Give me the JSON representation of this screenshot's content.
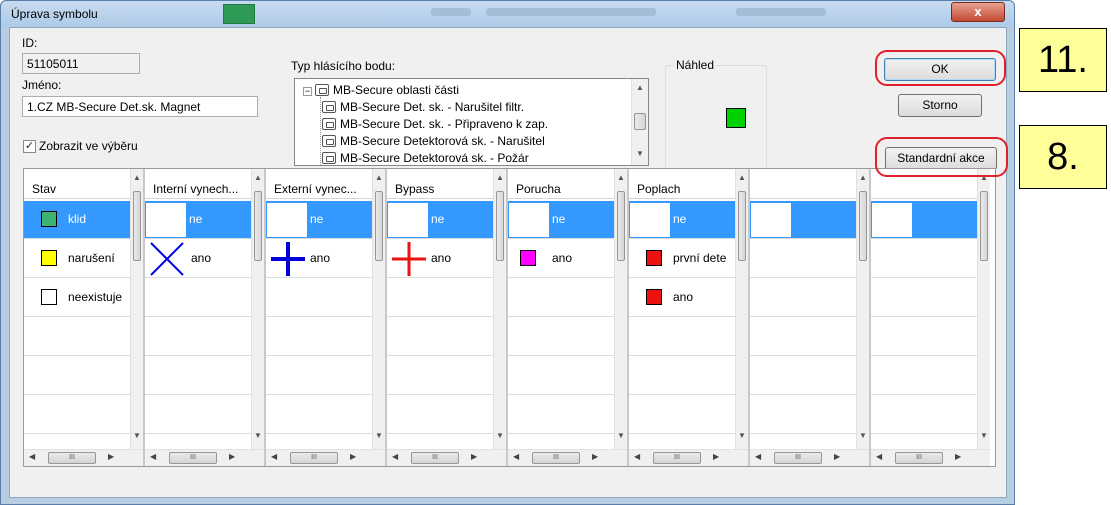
{
  "window": {
    "title": "Úprava symbolu",
    "close_label": "x"
  },
  "form": {
    "id_label": "ID:",
    "id_value": "51105011",
    "name_label": "Jméno:",
    "name_value": "1.CZ MB-Secure Det.sk. Magnet",
    "show_in_selection_label": "Zobrazit ve výběru",
    "show_in_selection_checked": true
  },
  "tree": {
    "label": "Typ hlásícího bodu:",
    "items": [
      {
        "label": "MB-Secure oblasti části",
        "level": 0
      },
      {
        "label": "MB-Secure Det. sk. - Narušitel filtr.",
        "level": 1
      },
      {
        "label": "MB-Secure Det. sk. - Připraveno k zap.",
        "level": 1
      },
      {
        "label": "MB-Secure Detektorová sk. - Narušitel",
        "level": 1
      },
      {
        "label": "MB-Secure Detektorová sk. - Požár",
        "level": 1
      }
    ]
  },
  "preview": {
    "label": "Náhled",
    "color": "#00d200"
  },
  "buttons": {
    "ok": "OK",
    "cancel": "Storno",
    "standard": "Standardní akce"
  },
  "callouts": {
    "first": "11.",
    "second": "8."
  },
  "columns": [
    {
      "header": "Stav",
      "rows": [
        {
          "text": "klid",
          "selected": true,
          "color": "#3cb371"
        },
        {
          "text": "narušení",
          "color": "#ffff00"
        },
        {
          "text": "neexistuje",
          "color": "#ffffff"
        }
      ]
    },
    {
      "header": "Interní vynech...",
      "rows": [
        {
          "text": "ne",
          "selected": true
        },
        {
          "text": "ano",
          "icon": "blue-x-icon"
        }
      ]
    },
    {
      "header": "Externí vynec...",
      "rows": [
        {
          "text": "ne",
          "selected": true
        },
        {
          "text": "ano",
          "icon": "blue-plus-icon"
        }
      ]
    },
    {
      "header": "Bypass",
      "rows": [
        {
          "text": "ne",
          "selected": true
        },
        {
          "text": "ano",
          "icon": "red-plus-icon"
        }
      ]
    },
    {
      "header": "Porucha",
      "rows": [
        {
          "text": "ne",
          "selected": true
        },
        {
          "text": "ano",
          "color": "#ff00ff"
        }
      ]
    },
    {
      "header": "Poplach",
      "rows": [
        {
          "text": "ne",
          "selected": true
        },
        {
          "text": "první dete",
          "color": "#ee1111"
        },
        {
          "text": "ano",
          "color": "#ee1111"
        }
      ]
    },
    {
      "header": "",
      "rows": [
        {
          "text": "",
          "selected": true
        }
      ]
    },
    {
      "header": "",
      "rows": [
        {
          "text": "",
          "selected": true
        }
      ]
    }
  ]
}
